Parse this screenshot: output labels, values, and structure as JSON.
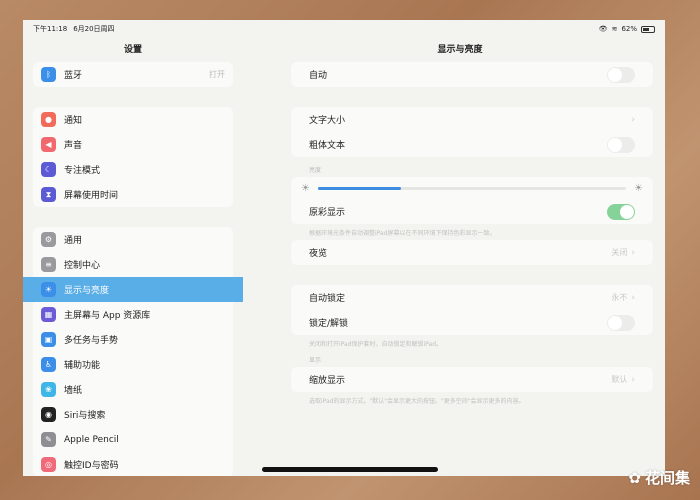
{
  "status": {
    "time": "下午11:18",
    "date": "6月20日周四",
    "battery": "62%",
    "battery_level": 0.62
  },
  "sidebar": {
    "title": "设置",
    "groups": [
      [
        {
          "label": "蓝牙",
          "value": "打开",
          "icon": "bluetooth-icon",
          "color": "#3b8fe8",
          "glyph": "ᛒ"
        }
      ],
      [
        {
          "label": "通知",
          "icon": "bell-icon",
          "color": "#f16a5a",
          "glyph": "●"
        },
        {
          "label": "声音",
          "icon": "speaker-icon",
          "color": "#f1686f",
          "glyph": "◀"
        },
        {
          "label": "专注模式",
          "icon": "moon-icon",
          "color": "#5b5bd6",
          "glyph": "☾"
        },
        {
          "label": "屏幕使用时间",
          "icon": "hourglass-icon",
          "color": "#5b5bd6",
          "glyph": "⧗"
        }
      ],
      [
        {
          "label": "通用",
          "icon": "gear-icon",
          "color": "#9a9a9e",
          "glyph": "⚙"
        },
        {
          "label": "控制中心",
          "icon": "control-center-icon",
          "color": "#9a9a9e",
          "glyph": "≡"
        },
        {
          "label": "显示与亮度",
          "icon": "brightness-icon",
          "color": "#3b8fe8",
          "glyph": "☀",
          "active": true
        },
        {
          "label": "主屏幕与 App 资源库",
          "icon": "home-grid-icon",
          "color": "#6b5bd6",
          "glyph": "▦"
        },
        {
          "label": "多任务与手势",
          "icon": "multitask-icon",
          "color": "#3b8fe8",
          "glyph": "▣"
        },
        {
          "label": "辅助功能",
          "icon": "accessibility-icon",
          "color": "#3b8fe8",
          "glyph": "♿"
        },
        {
          "label": "墙纸",
          "icon": "wallpaper-icon",
          "color": "#3fb6e8",
          "glyph": "❀"
        },
        {
          "label": "Siri与搜索",
          "icon": "siri-icon",
          "color": "#222222",
          "glyph": "◉"
        },
        {
          "label": "Apple Pencil",
          "icon": "pencil-icon",
          "color": "#8e8e93",
          "glyph": "✎"
        },
        {
          "label": "触控ID与密码",
          "icon": "fingerprint-icon",
          "color": "#f16a7a",
          "glyph": "◎"
        }
      ]
    ]
  },
  "main": {
    "title": "显示与亮度",
    "auto": "自动",
    "text_size": "文字大小",
    "bold_text": "粗体文本",
    "brightness_header": "亮度",
    "brightness_level": 0.27,
    "true_tone": "原彩显示",
    "true_tone_note": "根据环境光条件自动调整iPad屏幕以在不同环境下保持色彩显示一致。",
    "night_shift": "夜览",
    "night_shift_value": "关闭",
    "auto_lock": "自动锁定",
    "auto_lock_value": "永不",
    "lock_unlock": "锁定/解锁",
    "lock_note": "关闭和打开iPad保护套时，自动锁定和解锁iPad。",
    "display_header": "显示",
    "zoom": "缩放显示",
    "zoom_value": "默认",
    "zoom_note": "选取iPad的显示方式。\"默认\"会显示更大的按钮。\"更多空间\"会显示更多的内容。"
  },
  "watermark": "花间集"
}
